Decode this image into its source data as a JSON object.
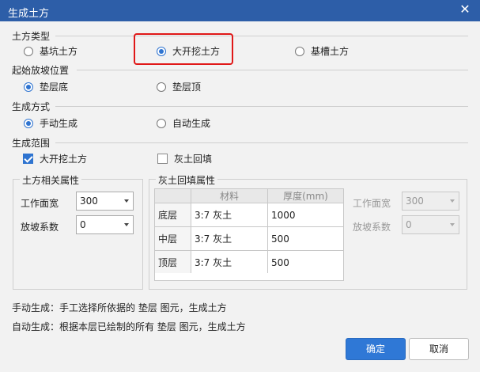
{
  "window": {
    "title": "生成土方"
  },
  "soil_type": {
    "label": "土方类型",
    "options": [
      {
        "label": "基坑土方",
        "selected": false
      },
      {
        "label": "大开挖土方",
        "selected": true
      },
      {
        "label": "基槽土方",
        "selected": false
      }
    ]
  },
  "slope_start": {
    "label": "起始放坡位置",
    "options": [
      {
        "label": "垫层底",
        "selected": true
      },
      {
        "label": "垫层顶",
        "selected": false
      }
    ]
  },
  "gen_method": {
    "label": "生成方式",
    "options": [
      {
        "label": "手动生成",
        "selected": true
      },
      {
        "label": "自动生成",
        "selected": false
      }
    ]
  },
  "gen_range": {
    "label": "生成范围",
    "options": [
      {
        "label": "大开挖土方",
        "checked": true
      },
      {
        "label": "灰土回填",
        "checked": false
      }
    ]
  },
  "soil_props": {
    "title": "土方相关属性",
    "work_width_label": "工作面宽",
    "work_width_value": "300",
    "slope_label": "放坡系数",
    "slope_value": "0"
  },
  "backfill_props": {
    "title": "灰土回填属性",
    "columns": [
      "",
      "材料",
      "厚度(mm)"
    ],
    "rows": [
      {
        "layer": "底层",
        "material": "3:7 灰土",
        "thickness": "1000"
      },
      {
        "layer": "中层",
        "material": "3:7 灰土",
        "thickness": "500"
      },
      {
        "layer": "顶层",
        "material": "3:7 灰土",
        "thickness": "500"
      }
    ],
    "work_width_label": "工作面宽",
    "work_width_value": "300",
    "slope_label": "放坡系数",
    "slope_value": "0"
  },
  "notes": {
    "manual": "手动生成：手工选择所依据的 垫层 图元，生成土方",
    "auto": "自动生成：根据本层已绘制的所有 垫层 图元，生成土方"
  },
  "buttons": {
    "ok": "确定",
    "cancel": "取消"
  },
  "colors": {
    "title_bar": "#2d5ea8",
    "accent": "#2f74d0",
    "highlight": "#e01818"
  }
}
